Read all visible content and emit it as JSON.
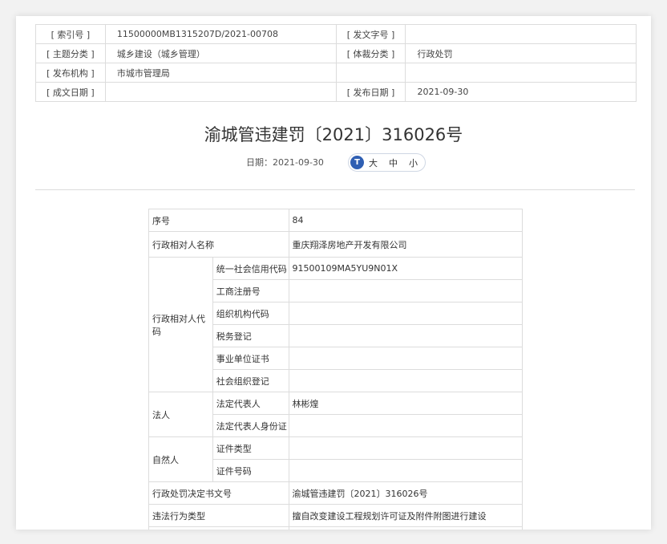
{
  "meta": {
    "index_label": "[ 索引号 ]",
    "index_value": "11500000MB1315207D/2021-00708",
    "doc_no_label": "[ 发文字号 ]",
    "doc_no_value": "",
    "topic_label": "[ 主题分类 ]",
    "topic_value": "城乡建设（城乡管理）",
    "genre_label": "[ 体裁分类 ]",
    "genre_value": "行政处罚",
    "publisher_label": "[ 发布机构 ]",
    "publisher_value": "市城市管理局",
    "created_label": "[ 成文日期 ]",
    "created_value": "",
    "published_label": "[ 发布日期 ]",
    "published_value": "2021-09-30"
  },
  "doc": {
    "title": "渝城管违建罚〔2021〕316026号",
    "date_label": "日期：",
    "date_value": "2021-09-30"
  },
  "font_size": {
    "icon": "T",
    "large": "大",
    "medium": "中",
    "small": "小"
  },
  "detail": {
    "seq_label": "序号",
    "seq_value": "84",
    "name_label": "行政相对人名称",
    "name_value": "重庆翔泽房地产开发有限公司",
    "code_group": "行政相对人代码",
    "credit_code_label": "统一社会信用代码",
    "credit_code_value": "91500109MA5YU9N01X",
    "biz_reg_label": "工商注册号",
    "org_code_label": "组织机构代码",
    "tax_label": "税务登记",
    "inst_cert_label": "事业单位证书",
    "social_org_label": "社会组织登记",
    "legal_group": "法人",
    "legal_rep_label": "法定代表人",
    "legal_rep_value": "林彬煌",
    "legal_id_label": "法定代表人身份证",
    "natural_group": "自然人",
    "cert_type_label": "证件类型",
    "cert_no_label": "证件号码",
    "decision_no_label": "行政处罚决定书文号",
    "decision_no_value": "渝城管违建罚〔2021〕316026号",
    "violation_label": "违法行为类型",
    "violation_value": "擅自改变建设工程规划许可证及附件附图进行建设"
  }
}
